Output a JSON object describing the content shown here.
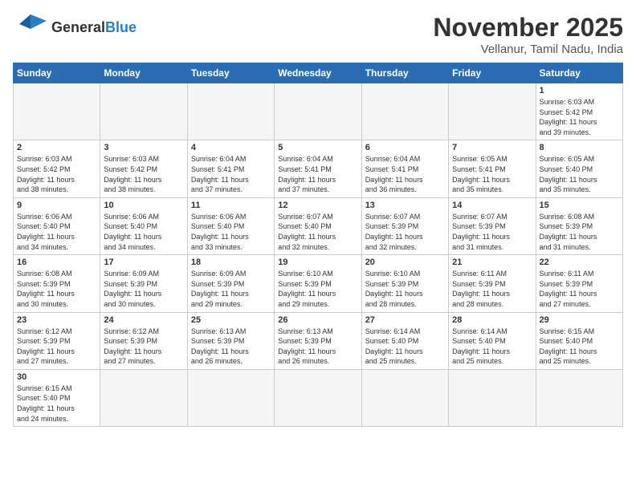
{
  "header": {
    "logo_general": "General",
    "logo_blue": "Blue",
    "month_title": "November 2025",
    "subtitle": "Vellanur, Tamil Nadu, India"
  },
  "days_of_week": [
    "Sunday",
    "Monday",
    "Tuesday",
    "Wednesday",
    "Thursday",
    "Friday",
    "Saturday"
  ],
  "weeks": [
    [
      {
        "day": "",
        "info": ""
      },
      {
        "day": "",
        "info": ""
      },
      {
        "day": "",
        "info": ""
      },
      {
        "day": "",
        "info": ""
      },
      {
        "day": "",
        "info": ""
      },
      {
        "day": "",
        "info": ""
      },
      {
        "day": "1",
        "info": "Sunrise: 6:03 AM\nSunset: 5:42 PM\nDaylight: 11 hours\nand 39 minutes."
      }
    ],
    [
      {
        "day": "2",
        "info": "Sunrise: 6:03 AM\nSunset: 5:42 PM\nDaylight: 11 hours\nand 38 minutes."
      },
      {
        "day": "3",
        "info": "Sunrise: 6:03 AM\nSunset: 5:42 PM\nDaylight: 11 hours\nand 38 minutes."
      },
      {
        "day": "4",
        "info": "Sunrise: 6:04 AM\nSunset: 5:41 PM\nDaylight: 11 hours\nand 37 minutes."
      },
      {
        "day": "5",
        "info": "Sunrise: 6:04 AM\nSunset: 5:41 PM\nDaylight: 11 hours\nand 37 minutes."
      },
      {
        "day": "6",
        "info": "Sunrise: 6:04 AM\nSunset: 5:41 PM\nDaylight: 11 hours\nand 36 minutes."
      },
      {
        "day": "7",
        "info": "Sunrise: 6:05 AM\nSunset: 5:41 PM\nDaylight: 11 hours\nand 35 minutes."
      },
      {
        "day": "8",
        "info": "Sunrise: 6:05 AM\nSunset: 5:40 PM\nDaylight: 11 hours\nand 35 minutes."
      }
    ],
    [
      {
        "day": "9",
        "info": "Sunrise: 6:06 AM\nSunset: 5:40 PM\nDaylight: 11 hours\nand 34 minutes."
      },
      {
        "day": "10",
        "info": "Sunrise: 6:06 AM\nSunset: 5:40 PM\nDaylight: 11 hours\nand 34 minutes."
      },
      {
        "day": "11",
        "info": "Sunrise: 6:06 AM\nSunset: 5:40 PM\nDaylight: 11 hours\nand 33 minutes."
      },
      {
        "day": "12",
        "info": "Sunrise: 6:07 AM\nSunset: 5:40 PM\nDaylight: 11 hours\nand 32 minutes."
      },
      {
        "day": "13",
        "info": "Sunrise: 6:07 AM\nSunset: 5:39 PM\nDaylight: 11 hours\nand 32 minutes."
      },
      {
        "day": "14",
        "info": "Sunrise: 6:07 AM\nSunset: 5:39 PM\nDaylight: 11 hours\nand 31 minutes."
      },
      {
        "day": "15",
        "info": "Sunrise: 6:08 AM\nSunset: 5:39 PM\nDaylight: 11 hours\nand 31 minutes."
      }
    ],
    [
      {
        "day": "16",
        "info": "Sunrise: 6:08 AM\nSunset: 5:39 PM\nDaylight: 11 hours\nand 30 minutes."
      },
      {
        "day": "17",
        "info": "Sunrise: 6:09 AM\nSunset: 5:39 PM\nDaylight: 11 hours\nand 30 minutes."
      },
      {
        "day": "18",
        "info": "Sunrise: 6:09 AM\nSunset: 5:39 PM\nDaylight: 11 hours\nand 29 minutes."
      },
      {
        "day": "19",
        "info": "Sunrise: 6:10 AM\nSunset: 5:39 PM\nDaylight: 11 hours\nand 29 minutes."
      },
      {
        "day": "20",
        "info": "Sunrise: 6:10 AM\nSunset: 5:39 PM\nDaylight: 11 hours\nand 28 minutes."
      },
      {
        "day": "21",
        "info": "Sunrise: 6:11 AM\nSunset: 5:39 PM\nDaylight: 11 hours\nand 28 minutes."
      },
      {
        "day": "22",
        "info": "Sunrise: 6:11 AM\nSunset: 5:39 PM\nDaylight: 11 hours\nand 27 minutes."
      }
    ],
    [
      {
        "day": "23",
        "info": "Sunrise: 6:12 AM\nSunset: 5:39 PM\nDaylight: 11 hours\nand 27 minutes."
      },
      {
        "day": "24",
        "info": "Sunrise: 6:12 AM\nSunset: 5:39 PM\nDaylight: 11 hours\nand 27 minutes."
      },
      {
        "day": "25",
        "info": "Sunrise: 6:13 AM\nSunset: 5:39 PM\nDaylight: 11 hours\nand 26 minutes."
      },
      {
        "day": "26",
        "info": "Sunrise: 6:13 AM\nSunset: 5:39 PM\nDaylight: 11 hours\nand 26 minutes."
      },
      {
        "day": "27",
        "info": "Sunrise: 6:14 AM\nSunset: 5:40 PM\nDaylight: 11 hours\nand 25 minutes."
      },
      {
        "day": "28",
        "info": "Sunrise: 6:14 AM\nSunset: 5:40 PM\nDaylight: 11 hours\nand 25 minutes."
      },
      {
        "day": "29",
        "info": "Sunrise: 6:15 AM\nSunset: 5:40 PM\nDaylight: 11 hours\nand 25 minutes."
      }
    ],
    [
      {
        "day": "30",
        "info": "Sunrise: 6:15 AM\nSunset: 5:40 PM\nDaylight: 11 hours\nand 24 minutes."
      },
      {
        "day": "",
        "info": ""
      },
      {
        "day": "",
        "info": ""
      },
      {
        "day": "",
        "info": ""
      },
      {
        "day": "",
        "info": ""
      },
      {
        "day": "",
        "info": ""
      },
      {
        "day": "",
        "info": ""
      }
    ]
  ]
}
